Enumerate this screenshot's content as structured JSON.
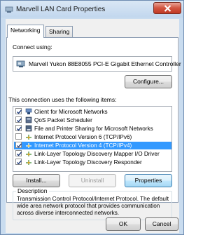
{
  "window": {
    "title": "Marvell LAN Card Properties"
  },
  "tabs": [
    {
      "label": "Networking",
      "active": true
    },
    {
      "label": "Sharing",
      "active": false
    }
  ],
  "connect": {
    "label": "Connect using:",
    "adapter": "Marvell Yukon 88E8055 PCI-E Gigabit Ethernet Controller",
    "configure_label": "Configure..."
  },
  "items_label": "This connection uses the following items:",
  "items": [
    {
      "label": "Client for Microsoft Networks",
      "checked": true,
      "icon": "network-client-icon"
    },
    {
      "label": "QoS Packet Scheduler",
      "checked": true,
      "icon": "scheduler-icon"
    },
    {
      "label": "File and Printer Sharing for Microsoft Networks",
      "checked": true,
      "icon": "file-printer-sharing-icon"
    },
    {
      "label": "Internet Protocol Version 6 (TCP/IPv6)",
      "checked": false,
      "icon": "protocol-icon"
    },
    {
      "label": "Internet Protocol Version 4 (TCP/IPv4)",
      "checked": true,
      "icon": "protocol-icon",
      "selected": true
    },
    {
      "label": "Link-Layer Topology Discovery Mapper I/O Driver",
      "checked": true,
      "icon": "protocol-icon"
    },
    {
      "label": "Link-Layer Topology Discovery Responder",
      "checked": true,
      "icon": "protocol-icon"
    }
  ],
  "buttons": {
    "install": "Install...",
    "uninstall": "Uninstall",
    "properties": "Properties",
    "ok": "OK",
    "cancel": "Cancel"
  },
  "description": {
    "title": "Description",
    "text": "Transmission Control Protocol/Internet Protocol. The default wide area network protocol that provides communication across diverse interconnected networks."
  },
  "colors": {
    "selection": "#3399ff",
    "close_button": "#c94a36",
    "frame": "#c9dcef"
  }
}
